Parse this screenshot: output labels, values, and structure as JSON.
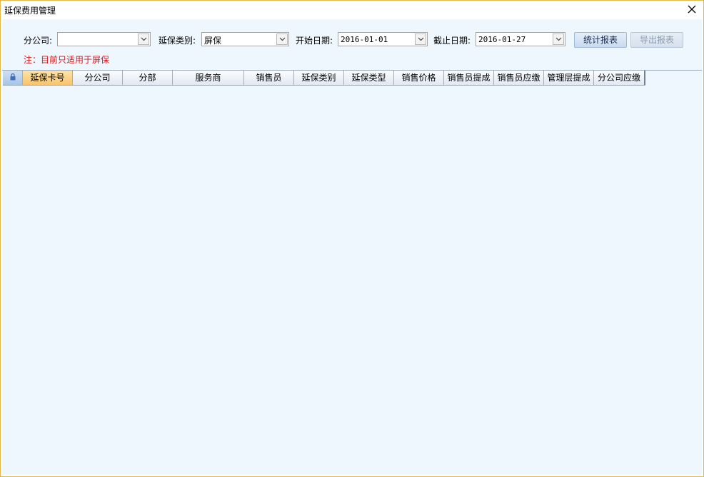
{
  "window": {
    "title": "延保费用管理"
  },
  "filters": {
    "branch_label": "分公司:",
    "branch_value": "",
    "type_label": "延保类别:",
    "type_value": "屏保",
    "start_label": "开始日期:",
    "start_value": "2016-01-01",
    "end_label": "截止日期:",
    "end_value": "2016-01-27"
  },
  "buttons": {
    "stats": "统计报表",
    "export": "导出报表"
  },
  "note": "注：目前只适用于屏保",
  "table": {
    "columns": [
      "延保卡号",
      "分公司",
      "分部",
      "服务商",
      "销售员",
      "延保类别",
      "延保类型",
      "销售价格",
      "销售员提成",
      "销售员应缴",
      "管理层提成",
      "分公司应缴"
    ],
    "rows": []
  },
  "colors": {
    "note": "#d11a1a",
    "sorted_header": "#f8c46b",
    "background": "#eef6fe"
  },
  "icons": {
    "close": "close-icon",
    "dropdown": "chevron-down-icon",
    "lock": "lock-icon"
  }
}
